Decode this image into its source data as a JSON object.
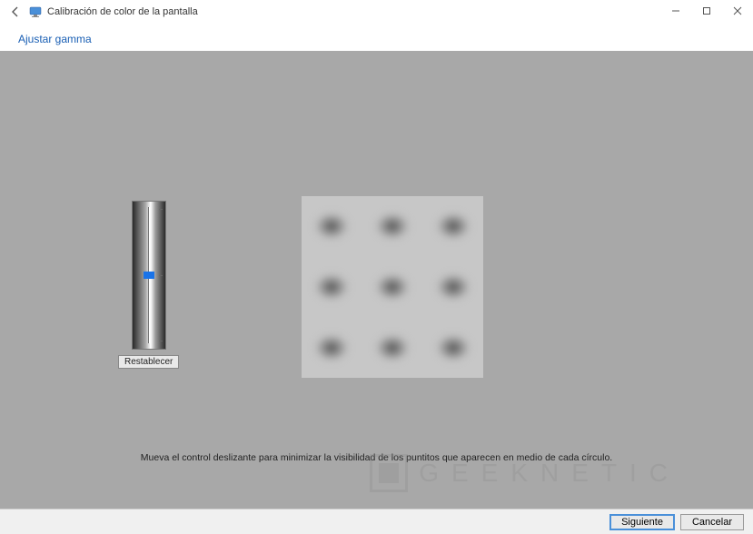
{
  "window": {
    "title": "Calibración de color de la pantalla"
  },
  "heading": "Ajustar gamma",
  "slider": {
    "reset_label": "Restablecer"
  },
  "instruction": "Mueva el control deslizante para minimizar la visibilidad de los puntitos que aparecen en medio de cada círculo.",
  "footer": {
    "next_label": "Siguiente",
    "cancel_label": "Cancelar"
  },
  "watermark": {
    "text": "GEEKNETIC"
  }
}
